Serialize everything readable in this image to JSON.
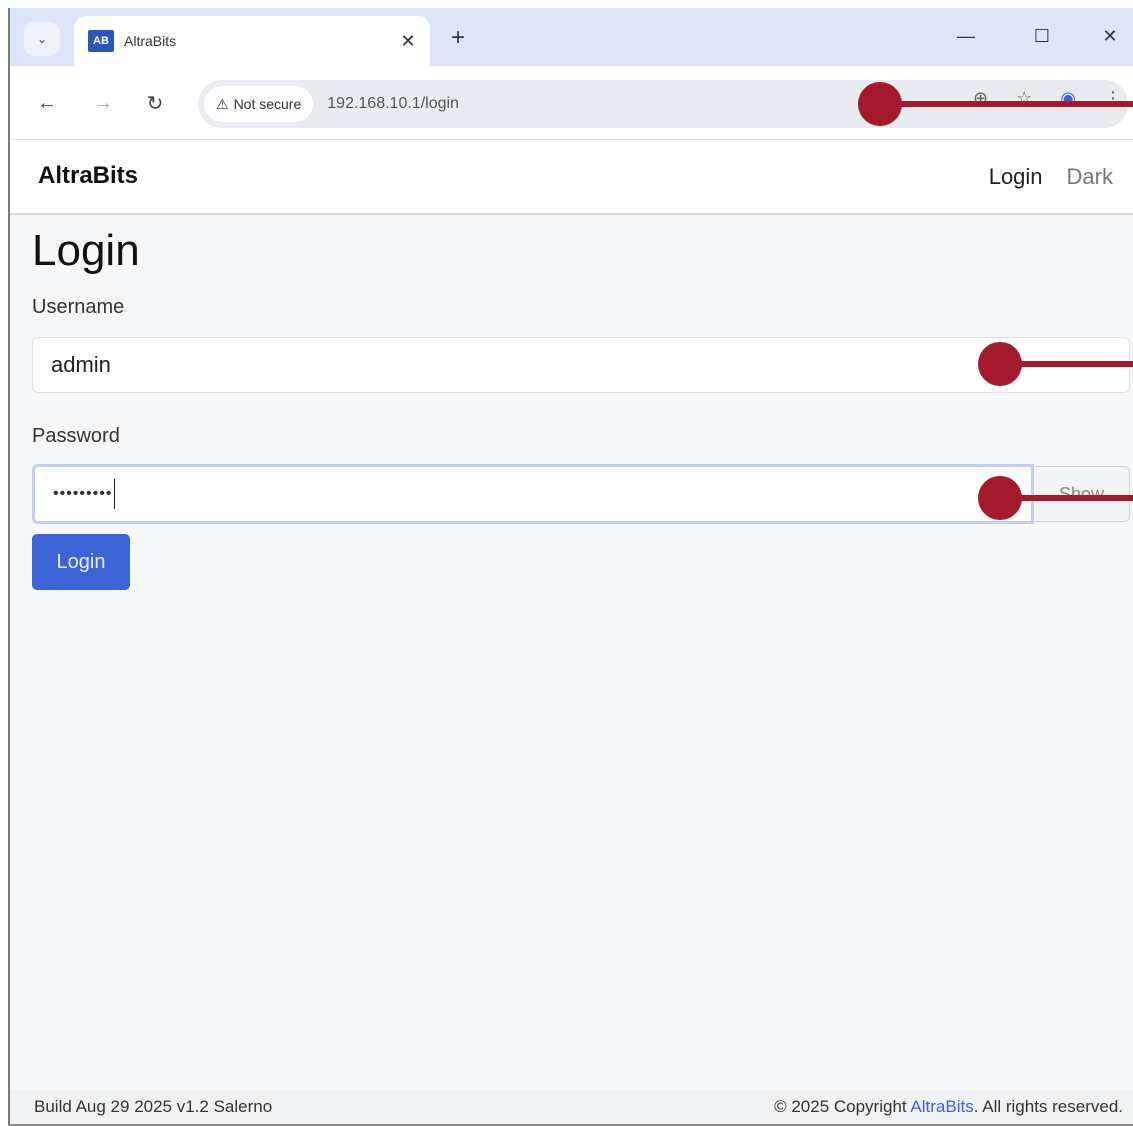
{
  "browser": {
    "tab_title": "AltraBits",
    "favicon_text": "AB",
    "tab_close": "✕",
    "new_tab": "+",
    "search_tabs": "⌄",
    "window_controls": {
      "minimize": "—",
      "maximize": "☐",
      "close": "✕"
    },
    "security_chip": "Not secure",
    "security_icon": "⚠",
    "url": "192.168.10.1/login",
    "nav": {
      "back": "←",
      "forward": "→",
      "reload": "↻"
    },
    "icons": [
      "translate-icon",
      "bookmark-icon",
      "profile-icon",
      "menu-icon"
    ],
    "icon_glyphs": {
      "translate": "⊕",
      "bookmark": "☆",
      "profile": "◉",
      "menu": "⋮"
    }
  },
  "app": {
    "brand": "AltraBits",
    "nav_links": {
      "login": "Login",
      "dark": "Dark"
    }
  },
  "form": {
    "title": "Login",
    "username_label": "Username",
    "username_value": "admin",
    "password_label": "Password",
    "password_value": "•••••••••",
    "show_button": "Show",
    "submit_button": "Login"
  },
  "footer": {
    "build": "Build Aug 29 2025 v1.2 Salerno",
    "copyright_prefix": "© 2025 Copyright ",
    "copyright_brand": "AltraBits",
    "copyright_suffix": ". All rights reserved."
  },
  "colors": {
    "marker": "#a4192c",
    "primary": "#3d64d6",
    "tabstrip": "#dce6f8"
  }
}
